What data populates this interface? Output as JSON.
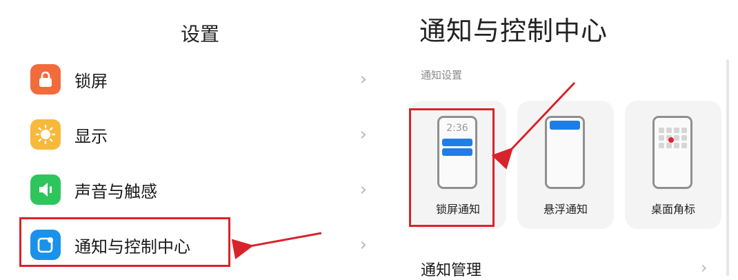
{
  "settings": {
    "title": "设置",
    "items": [
      {
        "label": "锁屏",
        "icon": "lock-icon",
        "color": "#f26b3a"
      },
      {
        "label": "显示",
        "icon": "sun-icon",
        "color": "#f6b93a"
      },
      {
        "label": "声音与触感",
        "icon": "speaker-icon",
        "color": "#2ec55c"
      },
      {
        "label": "通知与控制中心",
        "icon": "notification-icon",
        "color": "#1a92ea"
      }
    ]
  },
  "notification_center": {
    "title": "通知与控制中心",
    "section_label": "通知设置",
    "cards": [
      {
        "label": "锁屏通知",
        "preview_time": "2:36"
      },
      {
        "label": "悬浮通知"
      },
      {
        "label": "桌面角标"
      }
    ],
    "manage_label": "通知管理"
  },
  "colors": {
    "highlight": "#d8232a",
    "accent": "#1f7ee6"
  }
}
